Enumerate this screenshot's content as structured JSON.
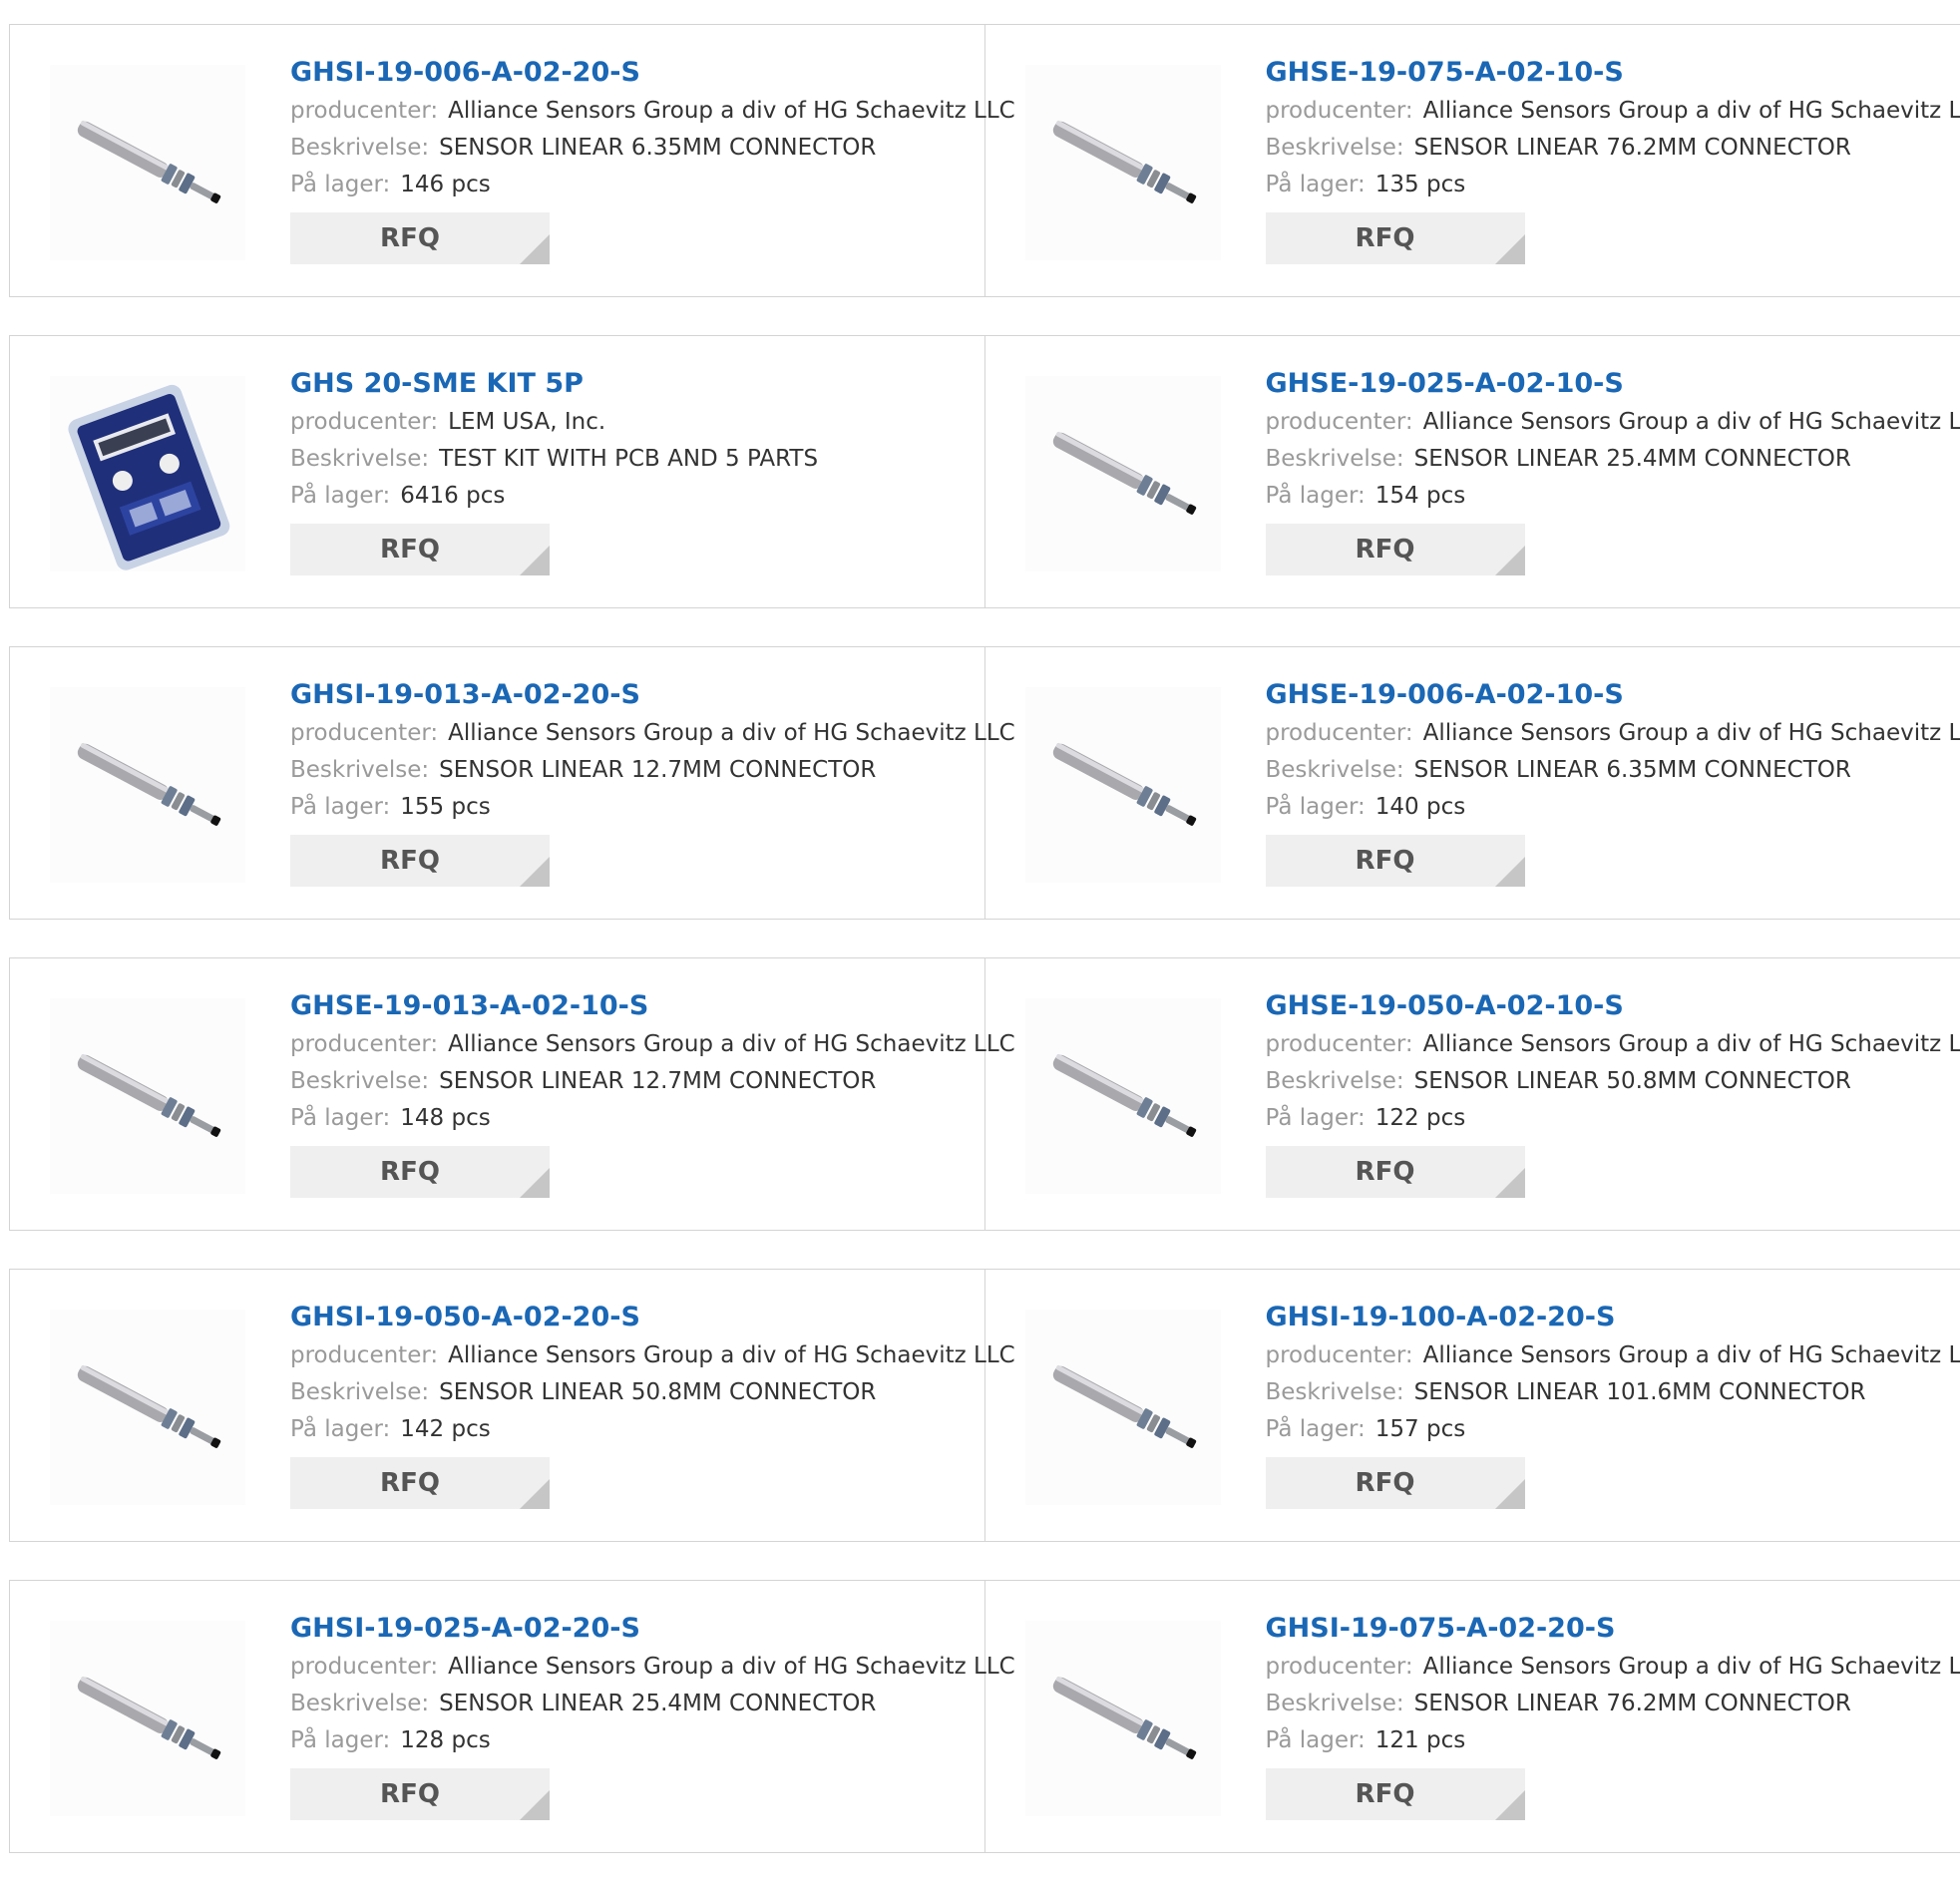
{
  "labels": {
    "manufacturer": "producenter:",
    "description": "Beskrivelse:",
    "stock": "På lager:",
    "rfq": "RFQ"
  },
  "products": [
    {
      "part": "GHSI-19-006-A-02-20-S",
      "manufacturer": "Alliance Sensors Group a div of HG Schaevitz LLC",
      "description": "SENSOR LINEAR 6.35MM CONNECTOR",
      "stock": "146 pcs",
      "image": "linear-sensor"
    },
    {
      "part": "GHSE-19-075-A-02-10-S",
      "manufacturer": "Alliance Sensors Group a div of HG Schaevitz LLC",
      "description": "SENSOR LINEAR 76.2MM CONNECTOR",
      "stock": "135 pcs",
      "image": "linear-sensor"
    },
    {
      "part": "GHS 20-SME KIT 5P",
      "manufacturer": "LEM USA, Inc.",
      "description": "TEST KIT WITH PCB AND 5 PARTS",
      "stock": "6416 pcs",
      "image": "test-kit"
    },
    {
      "part": "GHSE-19-025-A-02-10-S",
      "manufacturer": "Alliance Sensors Group a div of HG Schaevitz LLC",
      "description": "SENSOR LINEAR 25.4MM CONNECTOR",
      "stock": "154 pcs",
      "image": "linear-sensor"
    },
    {
      "part": "GHSI-19-013-A-02-20-S",
      "manufacturer": "Alliance Sensors Group a div of HG Schaevitz LLC",
      "description": "SENSOR LINEAR 12.7MM CONNECTOR",
      "stock": "155 pcs",
      "image": "linear-sensor"
    },
    {
      "part": "GHSE-19-006-A-02-10-S",
      "manufacturer": "Alliance Sensors Group a div of HG Schaevitz LLC",
      "description": "SENSOR LINEAR 6.35MM CONNECTOR",
      "stock": "140 pcs",
      "image": "linear-sensor"
    },
    {
      "part": "GHSE-19-013-A-02-10-S",
      "manufacturer": "Alliance Sensors Group a div of HG Schaevitz LLC",
      "description": "SENSOR LINEAR 12.7MM CONNECTOR",
      "stock": "148 pcs",
      "image": "linear-sensor"
    },
    {
      "part": "GHSE-19-050-A-02-10-S",
      "manufacturer": "Alliance Sensors Group a div of HG Schaevitz LLC",
      "description": "SENSOR LINEAR 50.8MM CONNECTOR",
      "stock": "122 pcs",
      "image": "linear-sensor"
    },
    {
      "part": "GHSI-19-050-A-02-20-S",
      "manufacturer": "Alliance Sensors Group a div of HG Schaevitz LLC",
      "description": "SENSOR LINEAR 50.8MM CONNECTOR",
      "stock": "142 pcs",
      "image": "linear-sensor"
    },
    {
      "part": "GHSI-19-100-A-02-20-S",
      "manufacturer": "Alliance Sensors Group a div of HG Schaevitz LLC",
      "description": "SENSOR LINEAR 101.6MM CONNECTOR",
      "stock": "157 pcs",
      "image": "linear-sensor"
    },
    {
      "part": "GHSI-19-025-A-02-20-S",
      "manufacturer": "Alliance Sensors Group a div of HG Schaevitz LLC",
      "description": "SENSOR LINEAR 25.4MM CONNECTOR",
      "stock": "128 pcs",
      "image": "linear-sensor"
    },
    {
      "part": "GHSI-19-075-A-02-20-S",
      "manufacturer": "Alliance Sensors Group a div of HG Schaevitz LLC",
      "description": "SENSOR LINEAR 76.2MM CONNECTOR",
      "stock": "121 pcs",
      "image": "linear-sensor"
    }
  ],
  "colors": {
    "title": "#1a67b5",
    "label": "#9a9a9a",
    "value": "#333333",
    "button_bg": "#efefef",
    "border": "#d4d4d4"
  }
}
